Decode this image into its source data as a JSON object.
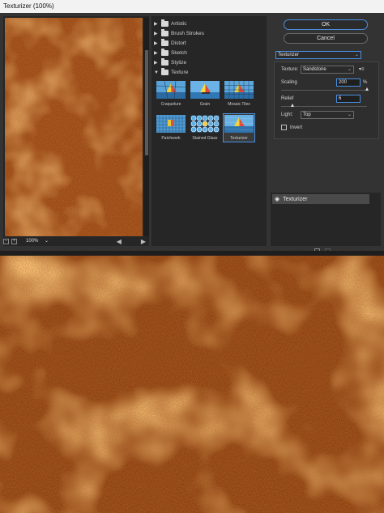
{
  "window": {
    "title": "Texturizer (100%)"
  },
  "preview": {
    "zoom": "100%",
    "zoom_chevron": "⌄",
    "minus": "−",
    "plus": "+",
    "left_arrow": "◀",
    "right_arrow": "▶"
  },
  "gallery": {
    "categories": [
      {
        "label": "Artistic",
        "expanded": false
      },
      {
        "label": "Brush Strokes",
        "expanded": false
      },
      {
        "label": "Distort",
        "expanded": false
      },
      {
        "label": "Sketch",
        "expanded": false
      },
      {
        "label": "Stylize",
        "expanded": false
      },
      {
        "label": "Texture",
        "expanded": true
      }
    ],
    "filters": [
      "Craquelure",
      "Grain",
      "Mosaic Tiles",
      "Patchwork",
      "Stained Glass",
      "Texturizer"
    ],
    "selected_filter": "Texturizer"
  },
  "buttons": {
    "ok": "OK",
    "cancel": "Cancel"
  },
  "settings": {
    "filter_select": "Texturizer",
    "texture_label": "Texture:",
    "texture_value": "Sandstone",
    "scaling_label": "Scaling",
    "scaling_value": "200",
    "scaling_unit": "%",
    "relief_label": "Relief",
    "relief_value": "6",
    "light_label": "Light:",
    "light_value": "Top",
    "invert_label": "Invert",
    "invert_checked": false,
    "menu_glyph": "▾≡"
  },
  "layers": {
    "rows": [
      {
        "label": "Texturizer",
        "visible": true
      }
    ]
  },
  "colors": {
    "accent": "#4a90e2",
    "panel": "#333333",
    "dark": "#262626",
    "texture_base": "#b5531a",
    "texture_light": "#e07a2a",
    "texture_dark": "#6a2c0a"
  }
}
